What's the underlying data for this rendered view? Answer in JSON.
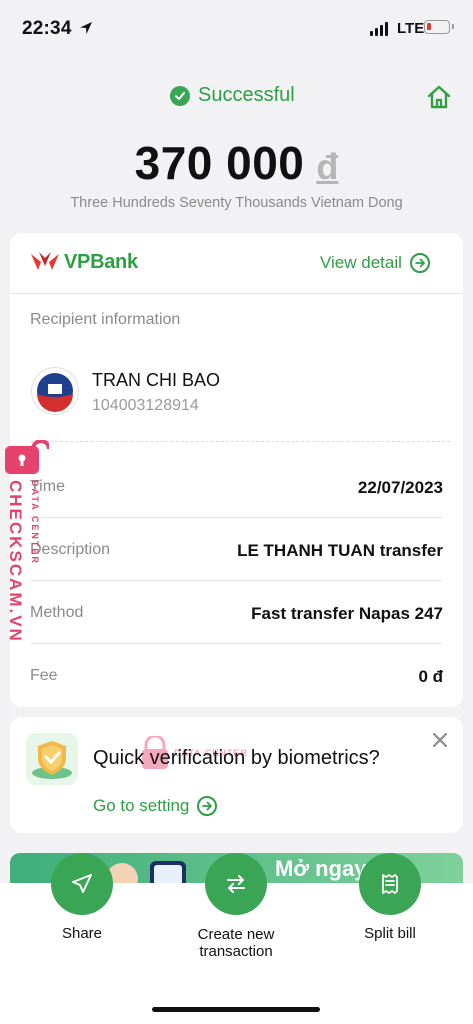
{
  "status_bar": {
    "time": "22:34",
    "network": "LTE"
  },
  "header": {
    "status": "Successful",
    "amount": "370 000",
    "currency": "đ",
    "amount_words": "Three Hundreds Seventy Thousands Vietnam Dong"
  },
  "bank": {
    "name_vp": "VP",
    "name_bank": "Bank",
    "view_detail": "View detail"
  },
  "recipient": {
    "section_label": "Recipient information",
    "name": "TRAN CHI BAO",
    "account": "104003128914"
  },
  "details": [
    {
      "label": "Time",
      "value": "22/07/2023"
    },
    {
      "label": "Description",
      "value": "LE THANH TUAN transfer"
    },
    {
      "label": "Method",
      "value": "Fast transfer Napas 247"
    },
    {
      "label": "Fee",
      "value": "0 đ"
    }
  ],
  "biometric": {
    "title": "Quick verification by biometrics?",
    "action": "Go to setting"
  },
  "banner": {
    "text": "Mở ngay"
  },
  "actions": [
    {
      "label": "Share"
    },
    {
      "label": "Create new\ntransaction"
    },
    {
      "label": "Split bill"
    }
  ],
  "watermark": {
    "brand": "CHECKSCAM.VN",
    "sub": "DATA CENTER"
  },
  "colors": {
    "accent": "#3aa655",
    "text_green": "#2f9e44",
    "watermark": "#e6426e"
  }
}
